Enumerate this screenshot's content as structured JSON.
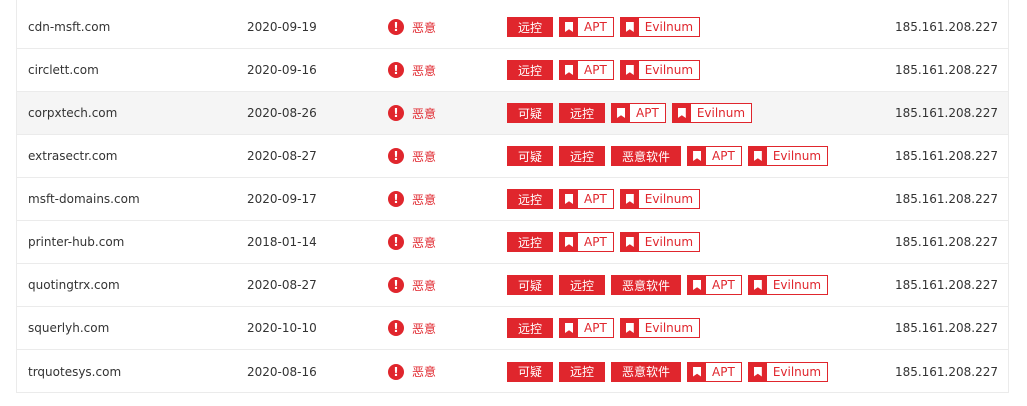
{
  "colors": {
    "accent": "#e0262d",
    "text": "#333333",
    "border": "#ebebeb",
    "highlight_row": "#f5f5f5"
  },
  "rows": [
    {
      "domain": "cdn-msft.com",
      "date": "2020-09-19",
      "threat": "恶意",
      "solid_tags": [
        "远控"
      ],
      "outline_tags": [
        "APT",
        "Evilnum"
      ],
      "ip": "185.161.208.227"
    },
    {
      "domain": "circlett.com",
      "date": "2020-09-16",
      "threat": "恶意",
      "solid_tags": [
        "远控"
      ],
      "outline_tags": [
        "APT",
        "Evilnum"
      ],
      "ip": "185.161.208.227"
    },
    {
      "domain": "corpxtech.com",
      "date": "2020-08-26",
      "threat": "恶意",
      "solid_tags": [
        "可疑",
        "远控"
      ],
      "outline_tags": [
        "APT",
        "Evilnum"
      ],
      "ip": "185.161.208.227"
    },
    {
      "domain": "extrasectr.com",
      "date": "2020-08-27",
      "threat": "恶意",
      "solid_tags": [
        "可疑",
        "远控",
        "恶意软件"
      ],
      "outline_tags": [
        "APT",
        "Evilnum"
      ],
      "ip": "185.161.208.227"
    },
    {
      "domain": "msft-domains.com",
      "date": "2020-09-17",
      "threat": "恶意",
      "solid_tags": [
        "远控"
      ],
      "outline_tags": [
        "APT",
        "Evilnum"
      ],
      "ip": "185.161.208.227"
    },
    {
      "domain": "printer-hub.com",
      "date": "2018-01-14",
      "threat": "恶意",
      "solid_tags": [
        "远控"
      ],
      "outline_tags": [
        "APT",
        "Evilnum"
      ],
      "ip": "185.161.208.227"
    },
    {
      "domain": "quotingtrx.com",
      "date": "2020-08-27",
      "threat": "恶意",
      "solid_tags": [
        "可疑",
        "远控",
        "恶意软件"
      ],
      "outline_tags": [
        "APT",
        "Evilnum"
      ],
      "ip": "185.161.208.227"
    },
    {
      "domain": "squerlyh.com",
      "date": "2020-10-10",
      "threat": "恶意",
      "solid_tags": [
        "远控"
      ],
      "outline_tags": [
        "APT",
        "Evilnum"
      ],
      "ip": "185.161.208.227"
    },
    {
      "domain": "trquotesys.com",
      "date": "2020-08-16",
      "threat": "恶意",
      "solid_tags": [
        "可疑",
        "远控",
        "恶意软件"
      ],
      "outline_tags": [
        "APT",
        "Evilnum"
      ],
      "ip": "185.161.208.227"
    }
  ],
  "icons": {
    "threat": "exclamation-circle-icon",
    "tag": "bookmark-icon"
  }
}
